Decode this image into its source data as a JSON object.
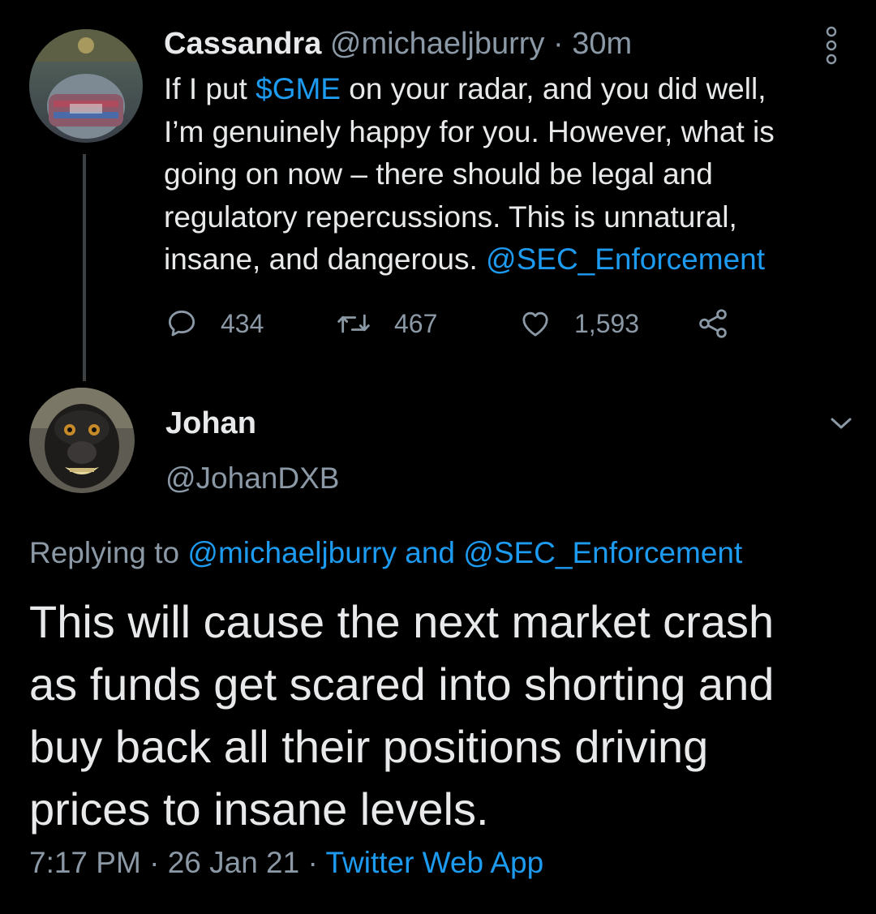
{
  "parent_tweet": {
    "author_name": "Cassandra",
    "author_handle": "@michaeljburry",
    "separator": " · ",
    "time": "30m",
    "text_lines": [
      [
        "If I put ",
        "$GME",
        " on your radar, and you did well,"
      ],
      "I’m genuinely happy for you. However, what is",
      "going on now – there should be legal and",
      "regulatory repercussions. This is unnatural,",
      [
        "insane, and dangerous. ",
        "@SEC_Enforcement"
      ]
    ],
    "stats": {
      "replies": "434",
      "retweets": "467",
      "likes": "1,593"
    },
    "icons": {
      "more": "more-vertical-icon",
      "reply": "reply-bubble-icon",
      "retweet": "retweet-icon",
      "like": "heart-icon",
      "share": "share-icon"
    }
  },
  "reply_tweet": {
    "author_name": "Johan",
    "author_handle": "@JohanDXB",
    "replying_prefix": "Replying to ",
    "replying_user1": "@michaeljburry",
    "replying_and": " and ",
    "replying_user2": "@SEC_Enforcement",
    "text_lines": [
      "This will cause the next market crash",
      "as funds get scared into shorting and",
      "buy back all their positions driving",
      "prices to insane levels."
    ],
    "time": "7:17 PM",
    "date": "26 Jan 21",
    "separator": " · ",
    "source": "Twitter Web App",
    "icons": {
      "menu": "chevron-down-icon"
    }
  },
  "colors": {
    "background": "#000000",
    "text_primary": "#e7e9ea",
    "text_secondary": "#8b98a5",
    "link": "#1d9bf0",
    "thread_line": "#3e4144"
  }
}
